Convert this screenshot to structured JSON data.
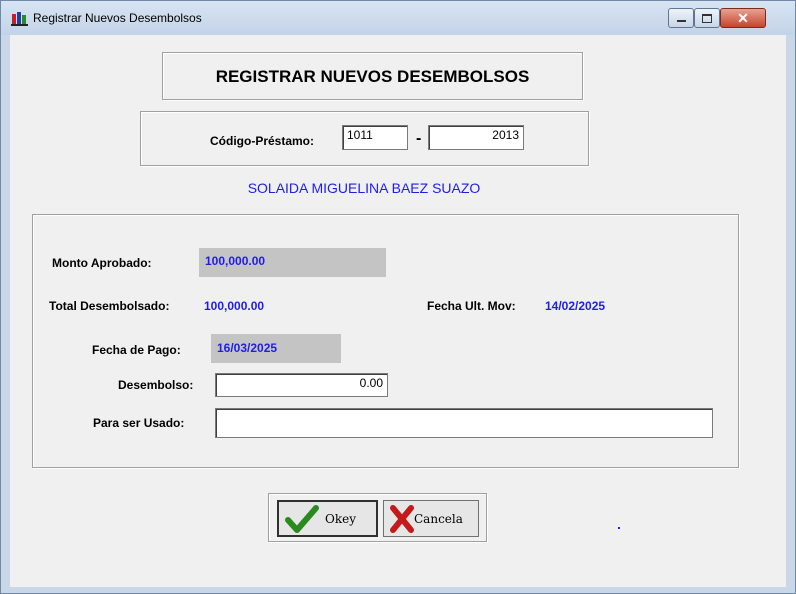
{
  "window": {
    "title": "Registrar Nuevos Desembolsos"
  },
  "form": {
    "heading": "REGISTRAR NUEVOS DESEMBOLSOS",
    "codigo_label": "Código-Préstamo:",
    "codigo_part1": "1011",
    "dash": "-",
    "codigo_part2": "2013",
    "client_name": "SOLAIDA MIGUELINA BAEZ SUAZO",
    "monto_aprobado_label": "Monto Aprobado:",
    "monto_aprobado_value": "100,000.00",
    "total_desembolsado_label": "Total Desembolsado:",
    "total_desembolsado_value": "100,000.00",
    "fecha_ult_mov_label": "Fecha Ult. Mov:",
    "fecha_ult_mov_value": "14/02/2025",
    "fecha_pago_label": "Fecha de Pago:",
    "fecha_pago_value": "16/03/2025",
    "desembolso_label": "Desembolso:",
    "desembolso_value": "0.00",
    "para_ser_usado_label": "Para ser Usado:",
    "para_ser_usado_value": ""
  },
  "buttons": {
    "okey": "Okey",
    "cancela": "Cancela"
  }
}
